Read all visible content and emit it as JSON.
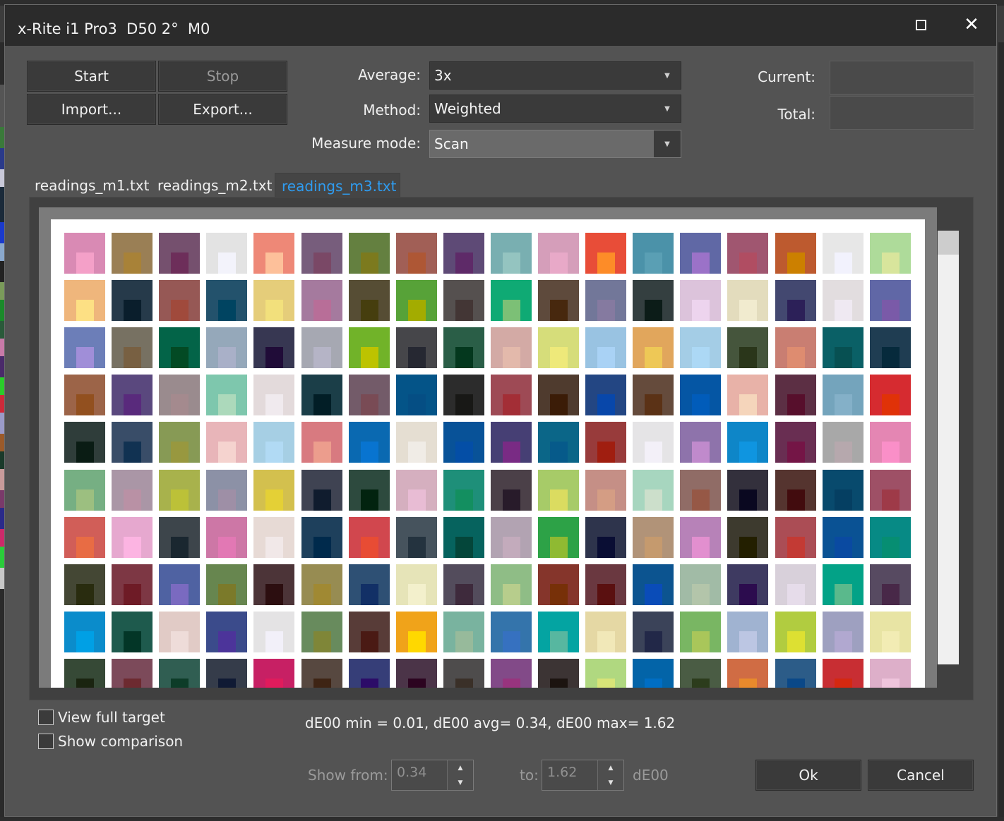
{
  "window": {
    "title": "x-Rite i1 Pro3  D50 2°  M0"
  },
  "buttons": {
    "start": "Start",
    "stop": "Stop",
    "import": "Import...",
    "export": "Export...",
    "ok": "Ok",
    "cancel": "Cancel"
  },
  "settings": {
    "average_label": "Average:",
    "average_value": "3x",
    "method_label": "Method:",
    "method_value": "Weighted",
    "measure_mode_label": "Measure mode:",
    "measure_mode_value": "Scan"
  },
  "counters": {
    "current_label": "Current:",
    "current_value": "",
    "total_label": "Total:",
    "total_value": ""
  },
  "tabs": [
    {
      "label": "readings_m1.txt",
      "active": false
    },
    {
      "label": "readings_m2.txt",
      "active": false
    },
    {
      "label": "readings_m3.txt",
      "active": true
    }
  ],
  "options": {
    "view_full_target": "View full target",
    "show_comparison": "Show comparison"
  },
  "stats": "dE00 min = 0.01, dE00 avg= 0.34, dE00 max= 1.62",
  "filter": {
    "show_from_label": "Show from:",
    "show_from_value": "0.34",
    "to_label": "to:",
    "to_value": "1.62",
    "unit": "dE00"
  },
  "colors": {
    "accent_tab": "#2f9cf0",
    "window_bg": "#535353",
    "titlebar": "#2b2b2b"
  },
  "patches": [
    [
      "#d98ab4",
      "#f4a0c8"
    ],
    [
      "#9a7f55",
      "#a88238"
    ],
    [
      "#75506e",
      "#6d2e5a"
    ],
    [
      "#e3e3e3",
      "#f3f3fb"
    ],
    [
      "#ee8877",
      "#fdc09a"
    ],
    [
      "#775d7c",
      "#7a4866"
    ],
    [
      "#648040",
      "#7c7a1e"
    ],
    [
      "#a15f56",
      "#ae5735"
    ],
    [
      "#5e4a76",
      "#5e2a68"
    ],
    [
      "#79afb1",
      "#94c4c0"
    ],
    [
      "#d59eba",
      "#e8a9c8"
    ],
    [
      "#e84d38",
      "#fd8c28"
    ],
    [
      "#4b92a9",
      "#5a9fb4"
    ],
    [
      "#6068a5",
      "#9b72c8"
    ],
    [
      "#a05670",
      "#b04d62"
    ],
    [
      "#bd5a2f",
      "#cc8000"
    ],
    [
      "#e7e7e7",
      "#f2f2fd"
    ],
    [
      "#aedb9a",
      "#d8e59c"
    ],
    [
      "#efb67c",
      "#fde084"
    ],
    [
      "#263a4a",
      "#0a1e2c"
    ],
    [
      "#965855",
      "#a04a3c"
    ],
    [
      "#23526c",
      "#004461"
    ],
    [
      "#e5cd7a",
      "#f2e07c"
    ],
    [
      "#a57a9e",
      "#b86e98"
    ],
    [
      "#564d34",
      "#463e0e"
    ],
    [
      "#57a238",
      "#a3ac00"
    ],
    [
      "#55504f",
      "#433635"
    ],
    [
      "#0faa74",
      "#7cc076"
    ],
    [
      "#5e4a3c",
      "#47280e"
    ],
    [
      "#727799",
      "#857aa0"
    ],
    [
      "#343f40",
      "#0c1c18"
    ],
    [
      "#dcc3db",
      "#edd4ee"
    ],
    [
      "#e3dcbd",
      "#f1ebcf"
    ],
    [
      "#434870",
      "#2c2058"
    ],
    [
      "#e2dddf",
      "#efe9f2"
    ],
    [
      "#6067a6",
      "#7a5aa8"
    ],
    [
      "#6c7eb8",
      "#a08ed8"
    ],
    [
      "#777162",
      "#786042"
    ],
    [
      "#036448",
      "#034a24"
    ],
    [
      "#95a8ba",
      "#a9b0c8"
    ],
    [
      "#373752",
      "#200c38"
    ],
    [
      "#a6a8b2",
      "#b5b4c6"
    ],
    [
      "#71b329",
      "#bdc300"
    ],
    [
      "#46464a",
      "#262832"
    ],
    [
      "#2a5e47",
      "#04381e"
    ],
    [
      "#d3aaa5",
      "#e3b9ab"
    ],
    [
      "#d6dd7a",
      "#eee97a"
    ],
    [
      "#99c3e2",
      "#a9d2f5"
    ],
    [
      "#e1a65c",
      "#eec856"
    ],
    [
      "#a4cde6",
      "#acd8f5"
    ],
    [
      "#45553c",
      "#2a361a"
    ],
    [
      "#c97e72",
      "#de8c70"
    ],
    [
      "#0a6066",
      "#075052"
    ],
    [
      "#1f3d52",
      "#062a3c"
    ],
    [
      "#9c6448",
      "#92501f"
    ],
    [
      "#5a487e",
      "#592a7c"
    ],
    [
      "#9a8b8e",
      "#a48a8e"
    ],
    [
      "#7ec7ad",
      "#acd9bb"
    ],
    [
      "#e3dadb",
      "#f0eaee"
    ],
    [
      "#1b3e48",
      "#021e26"
    ],
    [
      "#735b69",
      "#794b55"
    ],
    [
      "#045488",
      "#054e84"
    ],
    [
      "#2c2c2c",
      "#181816"
    ],
    [
      "#9e4a55",
      "#a32e36"
    ],
    [
      "#4f3b2e",
      "#3b1c07"
    ],
    [
      "#234683",
      "#0847aa"
    ],
    [
      "#654b3c",
      "#5b3216"
    ],
    [
      "#0556a4",
      "#015cba"
    ],
    [
      "#e8b2a8",
      "#f5d5bb"
    ],
    [
      "#5c2f44",
      "#570f2c"
    ],
    [
      "#74a4bc",
      "#84b0c8"
    ],
    [
      "#d62b30",
      "#e03208"
    ],
    [
      "#2f3d3a",
      "#0a1c14"
    ],
    [
      "#394d68",
      "#113252"
    ],
    [
      "#879a55",
      "#98983f"
    ],
    [
      "#e8b5b9",
      "#f5d3cf"
    ],
    [
      "#a6cfe4",
      "#b1daf4"
    ],
    [
      "#d87a80",
      "#ec9d8d"
    ],
    [
      "#0a69b1",
      "#0874d0"
    ],
    [
      "#e5ded2",
      "#f0ece6"
    ],
    [
      "#085298",
      "#044ea6"
    ],
    [
      "#463f74",
      "#792b84"
    ],
    [
      "#0b6688",
      "#065a8a"
    ],
    [
      "#983b3b",
      "#a01e10"
    ],
    [
      "#e5e4e6",
      "#f3f0f8"
    ],
    [
      "#8e73ab",
      "#c08acc"
    ],
    [
      "#0e86c8",
      "#0f95e0"
    ],
    [
      "#692e52",
      "#741546"
    ],
    [
      "#a8a8a8",
      "#b6a8ad"
    ],
    [
      "#e486b3",
      "#fa8fc8"
    ],
    [
      "#76af83",
      "#9cbf80"
    ],
    [
      "#aa96a6",
      "#b991a5"
    ],
    [
      "#a8b24c",
      "#bcc138"
    ],
    [
      "#8c91a6",
      "#9e8fa6"
    ],
    [
      "#d3c04e",
      "#e4d036"
    ],
    [
      "#3f4352",
      "#101c2e"
    ],
    [
      "#2d4a3e",
      "#02230f"
    ],
    [
      "#d5afbf",
      "#e8bcd4"
    ],
    [
      "#1e8f79",
      "#138f60"
    ],
    [
      "#4b4048",
      "#281b2a"
    ],
    [
      "#a7cb68",
      "#dbdc60"
    ],
    [
      "#c58f86",
      "#d49d84"
    ],
    [
      "#a7d6bf",
      "#ccdfcb"
    ],
    [
      "#906c66",
      "#965846"
    ],
    [
      "#33303c",
      "#0a0820"
    ],
    [
      "#55342f",
      "#420c0e"
    ],
    [
      "#084a6d",
      "#053f62"
    ],
    [
      "#9e5066",
      "#9e3a48"
    ],
    [
      "#d15e58",
      "#e86c44"
    ],
    [
      "#e6a8cf",
      "#fcb4e2"
    ],
    [
      "#3d454b",
      "#1a2730"
    ],
    [
      "#cd77a6",
      "#e278b4"
    ],
    [
      "#e7dad5",
      "#f1e8e8"
    ],
    [
      "#1e405c",
      "#002a4c"
    ],
    [
      "#d1474e",
      "#e84c34"
    ],
    [
      "#46535d",
      "#24333f"
    ],
    [
      "#06635e",
      "#04463a"
    ],
    [
      "#b2a3b2",
      "#c3abbc"
    ],
    [
      "#2da247",
      "#8fba32"
    ],
    [
      "#2e344c",
      "#0a0e34"
    ],
    [
      "#b19378",
      "#c59a6e"
    ],
    [
      "#b782b8",
      "#e28fcf"
    ],
    [
      "#3d3a2e",
      "#231f00"
    ],
    [
      "#ab4d55",
      "#c33a34"
    ],
    [
      "#0a5294",
      "#0a4aa1"
    ],
    [
      "#078a85",
      "#068e72"
    ],
    [
      "#444734",
      "#292c0f"
    ],
    [
      "#7d3744",
      "#6e1b26"
    ],
    [
      "#4f62a2",
      "#7a6ac0"
    ],
    [
      "#67864f",
      "#7b7a2a"
    ],
    [
      "#4c3438",
      "#2c0e10"
    ],
    [
      "#978c52",
      "#a08933"
    ],
    [
      "#2e5074",
      "#123066"
    ],
    [
      "#e6e4b8",
      "#f3f0cc"
    ],
    [
      "#534c5c",
      "#3e2a3c"
    ],
    [
      "#8fbd86",
      "#b7cd8c"
    ],
    [
      "#85352b",
      "#773008"
    ],
    [
      "#6a3840",
      "#5a1010"
    ],
    [
      "#0c5490",
      "#0a4cb8"
    ],
    [
      "#a1bba6",
      "#b3c5aa"
    ],
    [
      "#3e3a61",
      "#2c0c4e"
    ],
    [
      "#d8d0da",
      "#e6dcea"
    ],
    [
      "#03a287",
      "#5ab98c"
    ],
    [
      "#574a61",
      "#482848"
    ],
    [
      "#0b8ccb",
      "#00a0e5"
    ],
    [
      "#1e5a4d",
      "#033627"
    ],
    [
      "#e1cbc6",
      "#eedcd9"
    ],
    [
      "#3b4b8b",
      "#4c349a"
    ],
    [
      "#e4e3e4",
      "#f2f0f9"
    ],
    [
      "#688b5d",
      "#7f8638"
    ],
    [
      "#583c38",
      "#4a1a14"
    ],
    [
      "#f0a31a",
      "#ffd800"
    ],
    [
      "#79b39f",
      "#97ba9b"
    ],
    [
      "#3474ab",
      "#3671c0"
    ],
    [
      "#04a4a2",
      "#57b7a0"
    ],
    [
      "#e5d8a4",
      "#f1e8b8"
    ],
    [
      "#3b4359",
      "#222848"
    ],
    [
      "#79b663",
      "#a9c65a"
    ],
    [
      "#a0b3d1",
      "#bcc6e3"
    ],
    [
      "#b1cc40",
      "#dde032"
    ],
    [
      "#9ea0c0",
      "#b1a8d0"
    ],
    [
      "#e8e4a4",
      "#f2ecb4"
    ],
    [
      "#364936",
      "#1a2410"
    ],
    [
      "#7c4a5a",
      "#6d2a30"
    ],
    [
      "#305e52",
      "#0d3c28"
    ],
    [
      "#353c4a",
      "#101a34"
    ],
    [
      "#c72064",
      "#e01b5c"
    ],
    [
      "#574840",
      "#3e2414"
    ],
    [
      "#363e78",
      "#2c0c68"
    ],
    [
      "#4b3448",
      "#2c0420"
    ],
    [
      "#4e4c4c",
      "#3a3028"
    ],
    [
      "#824a88",
      "#98347e"
    ],
    [
      "#3c3434",
      "#1c1410"
    ],
    [
      "#b0d880",
      "#d8e478"
    ],
    [
      "#0364a8",
      "#006ec4"
    ],
    [
      "#4a5c44",
      "#2c3c1c"
    ],
    [
      "#d06c44",
      "#e88a2c"
    ],
    [
      "#2c5c88",
      "#0a4888"
    ],
    [
      "#c82e33",
      "#d42810"
    ],
    [
      "#ddafc9",
      "#efc4dc"
    ]
  ]
}
